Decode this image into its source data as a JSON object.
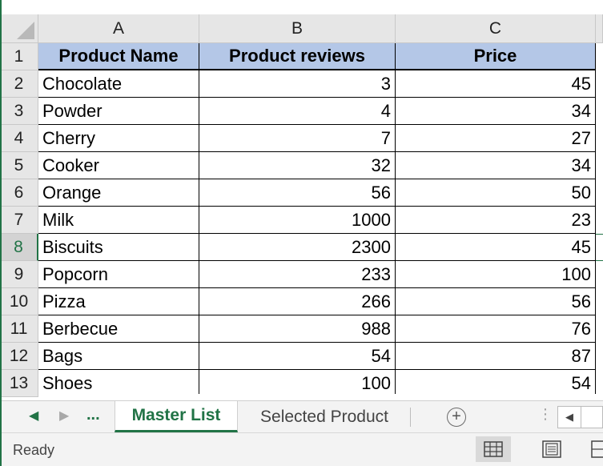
{
  "columns": [
    "A",
    "B",
    "C"
  ],
  "rows": [
    "1",
    "2",
    "3",
    "4",
    "5",
    "6",
    "7",
    "8",
    "9",
    "10",
    "11",
    "12",
    "13"
  ],
  "table": {
    "headers": [
      "Product Name",
      "Product reviews",
      "Price"
    ],
    "data": [
      [
        "Chocolate",
        "3",
        "45"
      ],
      [
        "Powder",
        "4",
        "34"
      ],
      [
        "Cherry",
        "7",
        "27"
      ],
      [
        "Cooker",
        "32",
        "34"
      ],
      [
        "Orange",
        "56",
        "50"
      ],
      [
        "Milk",
        "1000",
        "23"
      ],
      [
        "Biscuits",
        "2300",
        "45"
      ],
      [
        "Popcorn",
        "233",
        "100"
      ],
      [
        "Pizza",
        "266",
        "56"
      ],
      [
        "Berbecue",
        "988",
        "76"
      ],
      [
        "Bags",
        "54",
        "87"
      ],
      [
        "Shoes",
        "100",
        "54"
      ]
    ]
  },
  "selected_row": "8",
  "sheet_tabs": {
    "ellipsis": "...",
    "active": "Master List",
    "inactive": "Selected Product"
  },
  "status": {
    "text": "Ready"
  },
  "colors": {
    "accent": "#217346",
    "header_fill": "#b4c7e7"
  },
  "icons": [
    "scroll-left-icon",
    "scroll-right-icon",
    "add-sheet-icon",
    "normal-view-icon",
    "page-layout-icon",
    "page-break-icon"
  ]
}
